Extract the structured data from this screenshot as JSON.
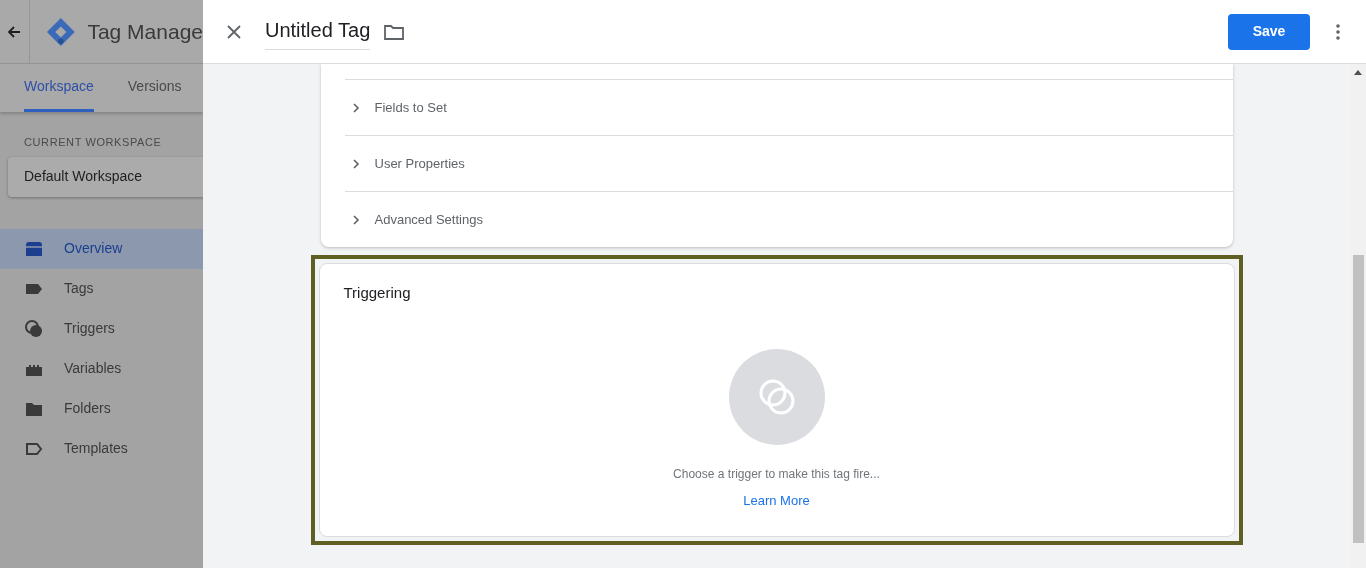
{
  "app": {
    "title": "Tag Manage",
    "tabs": [
      {
        "label": "Workspace",
        "selected": true
      },
      {
        "label": "Versions",
        "selected": false
      }
    ],
    "workspace_label": "CURRENT WORKSPACE",
    "workspace_name": "Default Workspace",
    "nav": [
      {
        "label": "Overview",
        "selected": true
      },
      {
        "label": "Tags",
        "selected": false
      },
      {
        "label": "Triggers",
        "selected": false
      },
      {
        "label": "Variables",
        "selected": false
      },
      {
        "label": "Folders",
        "selected": false
      },
      {
        "label": "Templates",
        "selected": false
      }
    ]
  },
  "panel": {
    "title": "Untitled Tag",
    "save": "Save",
    "sections": [
      {
        "label": "Fields to Set",
        "expanded": false
      },
      {
        "label": "User Properties",
        "expanded": false
      },
      {
        "label": "Advanced Settings",
        "expanded": false
      }
    ],
    "triggering": {
      "title": "Triggering",
      "message": "Choose a trigger to make this tag fire...",
      "link": "Learn More",
      "highlighted": true
    }
  }
}
